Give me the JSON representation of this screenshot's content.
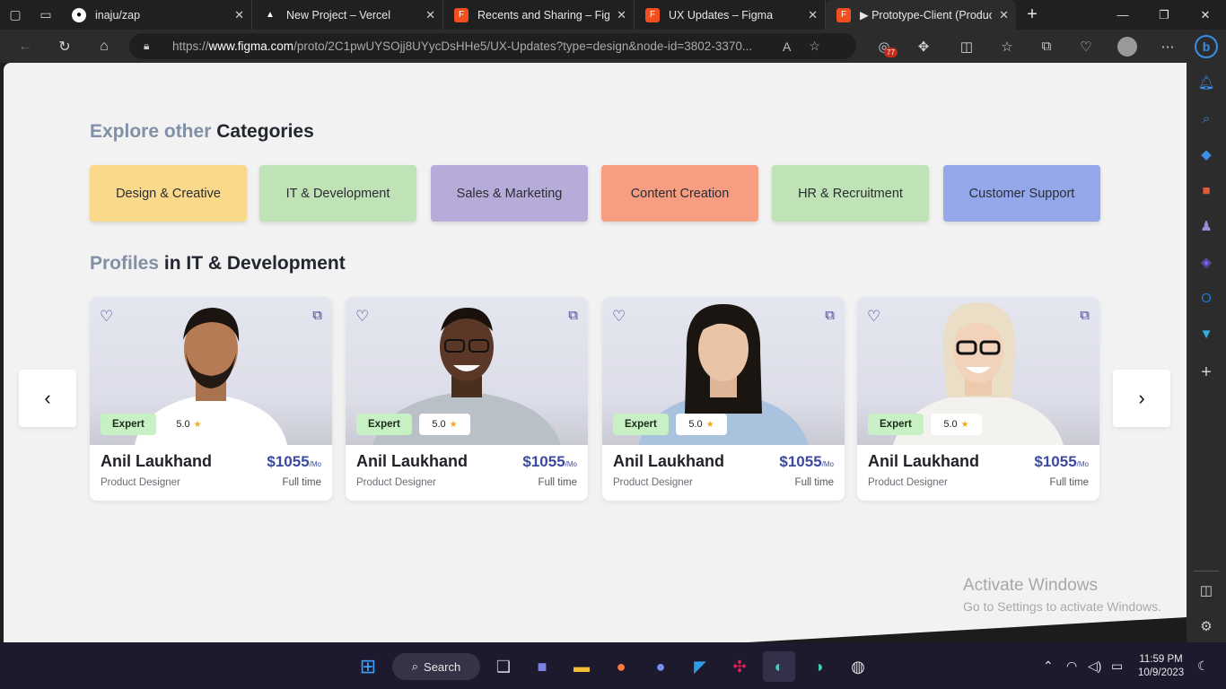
{
  "browser": {
    "tabs": [
      {
        "title": "inaju/zap",
        "icon": "github-icon",
        "color": "#ffffff"
      },
      {
        "title": "New Project – Vercel",
        "icon": "vercel-icon",
        "color": "#ffffff"
      },
      {
        "title": "Recents and Sharing – Figma",
        "icon": "figma-icon",
        "color": "#f24e1e"
      },
      {
        "title": "UX Updates – Figma",
        "icon": "figma-icon",
        "color": "#f24e1e"
      },
      {
        "title": "▶ Prototype-Client (Product…",
        "icon": "figma-icon",
        "color": "#f24e1e"
      }
    ],
    "url_prefix": "https://",
    "url_host": "www.figma.com",
    "url_path": "/proto/2C1pwUYSOjj8UYycDsHHe5/UX-Updates?type=design&node-id=3802-3370...",
    "extension_badge": "77"
  },
  "page": {
    "categories_title_muted": "Explore other",
    "categories_title_main": "Categories",
    "categories": [
      {
        "label": "Design & Creative",
        "color": "#fbd98a"
      },
      {
        "label": "IT & Development",
        "color": "#bfe3b6"
      },
      {
        "label": "Sales & Marketing",
        "color": "#b7acd9"
      },
      {
        "label": "Content Creation",
        "color": "#f79d81"
      },
      {
        "label": "HR & Recruitment",
        "color": "#bfe3b6"
      },
      {
        "label": "Customer Support",
        "color": "#93a7ea"
      }
    ],
    "profiles_title_muted": "Profiles",
    "profiles_title_main": "in IT & Development",
    "profiles": [
      {
        "name": "Anil Laukhand",
        "role": "Product Designer",
        "price": "$1055",
        "period": "/Mo",
        "type": "Full time",
        "badge": "Expert",
        "rating": "5.0"
      },
      {
        "name": "Anil Laukhand",
        "role": "Product Designer",
        "price": "$1055",
        "period": "/Mo",
        "type": "Full time",
        "badge": "Expert",
        "rating": "5.0"
      },
      {
        "name": "Anil Laukhand",
        "role": "Product Designer",
        "price": "$1055",
        "period": "/Mo",
        "type": "Full time",
        "badge": "Expert",
        "rating": "5.0"
      },
      {
        "name": "Anil Laukhand",
        "role": "Product Designer",
        "price": "$1055",
        "period": "/Mo",
        "type": "Full time",
        "badge": "Expert",
        "rating": "5.0"
      }
    ]
  },
  "watermark": {
    "line1": "Activate Windows",
    "line2": "Go to Settings to activate Windows."
  },
  "taskbar": {
    "search_label": "Search",
    "time": "11:59 PM",
    "date": "10/9/2023"
  }
}
